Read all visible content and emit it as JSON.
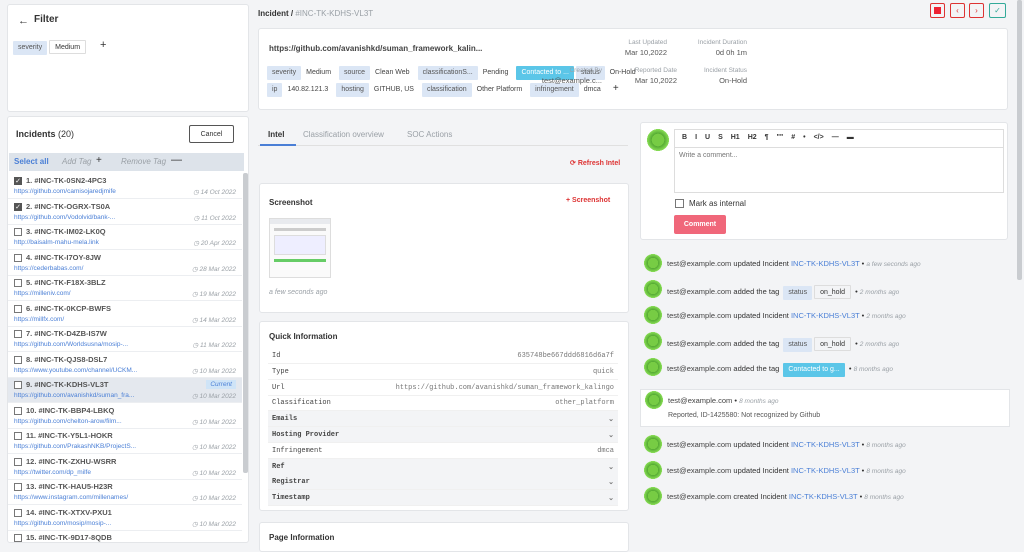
{
  "filter": {
    "title": "Filter",
    "chips": [
      {
        "key": "severity",
        "value": "Medium"
      }
    ]
  },
  "incidents": {
    "title": "Incidents",
    "count": "(20)",
    "cancel": "Cancel",
    "select_all": "Select all",
    "add_tag": "Add Tag",
    "remove_tag": "Remove Tag",
    "current_label": "Current",
    "items": [
      {
        "id": "1. #INC-TK-0SN2-4PC3",
        "url": "https://github.com/camisojaredjmife",
        "date": "14 Oct 2022",
        "checked": true
      },
      {
        "id": "2. #INC-TK-OGRX-TS0A",
        "url": "https://github.com/Vodolvid/bank-...",
        "date": "11 Oct 2022",
        "checked": true
      },
      {
        "id": "3. #INC-TK-IM02-LK0Q",
        "url": "http://baisalm-mahu-mela.link",
        "date": "20 Apr 2022",
        "checked": false
      },
      {
        "id": "4. #INC-TK-I7OY-8JW",
        "url": "https://cederbabas.com/",
        "date": "28 Mar 2022",
        "checked": false
      },
      {
        "id": "5. #INC-TK-F18X-3BLZ",
        "url": "https://milleniv.com/",
        "date": "19 Mar 2022",
        "checked": false
      },
      {
        "id": "6. #INC-TK-0KCP-BWFS",
        "url": "https://millfx.com/",
        "date": "14 Mar 2022",
        "checked": false
      },
      {
        "id": "7. #INC-TK-D4ZB-IS7W",
        "url": "https://github.com/Worldsusna/mosip-...",
        "date": "11 Mar 2022",
        "checked": false
      },
      {
        "id": "8. #INC-TK-QJS8-DSL7",
        "url": "https://www.youtube.com/channel/UCKM...",
        "date": "10 Mar 2022",
        "checked": false
      },
      {
        "id": "9. #INC-TK-KDHS-VL3T",
        "url": "https://github.com/avanishkd/suman_fra...",
        "date": "10 Mar 2022",
        "checked": false,
        "current": true
      },
      {
        "id": "10. #INC-TK-BBP4-LBKQ",
        "url": "https://github.com/chelton-arow/film...",
        "date": "10 Mar 2022",
        "checked": false
      },
      {
        "id": "11. #INC-TK-Y5L1-HOKR",
        "url": "https://github.com/PrakashNKB/ProjectS...",
        "date": "10 Mar 2022",
        "checked": false
      },
      {
        "id": "12. #INC-TK-ZXHU-WSRR",
        "url": "https://twitter.com/dp_milfe",
        "date": "10 Mar 2022",
        "checked": false
      },
      {
        "id": "13. #INC-TK-HAU5-H23R",
        "url": "https://www.instagram.com/millenames/",
        "date": "10 Mar 2022",
        "checked": false
      },
      {
        "id": "14. #INC-TK-XTXV-PXU1",
        "url": "https://github.com/mosip/mosip-...",
        "date": "10 Mar 2022",
        "checked": false
      },
      {
        "id": "15. #INC-TK-9D17-8QDB",
        "url": "",
        "date": "",
        "checked": false
      }
    ]
  },
  "header": {
    "crumb_label": "Incident /",
    "crumb_id": "#INC-TK-KDHS-VL3T"
  },
  "summary": {
    "url": "https://github.com/avanishkd/suman_framework_kalin...",
    "tags_row1": [
      {
        "k": "severity",
        "v": "Medium"
      },
      {
        "k": "source",
        "v": "Clean Web"
      },
      {
        "k": "classificationS...",
        "v": "Pending"
      },
      {
        "k": "Contacted to ...",
        "v": "",
        "highlight": true
      },
      {
        "k": "status",
        "v": "On-Hold"
      }
    ],
    "tags_row2": [
      {
        "k": "ip",
        "v": "140.82.121.3"
      },
      {
        "k": "hosting",
        "v": "GITHUB, US"
      },
      {
        "k": "classification",
        "v": "Other Platform"
      },
      {
        "k": "infringement",
        "v": "dmca"
      }
    ],
    "meta": [
      {
        "label": "Last Updated",
        "value": "Mar 10,2022"
      },
      {
        "label": "Incident Duration",
        "value": "0d 0h 1m"
      },
      {
        "label": "Created By",
        "value": "test@example.c..."
      },
      {
        "label": "Reported Date",
        "value": "Mar 10,2022"
      },
      {
        "label": "Incident Status",
        "value": "On-Hold"
      }
    ]
  },
  "tabs": [
    "Intel",
    "Classification overview",
    "SOC Actions"
  ],
  "refresh": "Refresh Intel",
  "screenshot": {
    "title": "Screenshot",
    "button": "Screenshot",
    "time": "a few seconds ago"
  },
  "quick": {
    "title": "Quick Information",
    "rows": [
      {
        "k": "Id",
        "v": "635748be667ddd6816d6a7f"
      },
      {
        "k": "Type",
        "v": "quick"
      },
      {
        "k": "Url",
        "v": "https://github.com/avanishkd/suman_framework_kalingo"
      },
      {
        "k": "Classification",
        "v": "other_platform"
      },
      {
        "k": "Emails",
        "v": "",
        "collapsible": true
      },
      {
        "k": "Hosting Provider",
        "v": "",
        "collapsible": true
      },
      {
        "k": "Infringement",
        "v": "dmca"
      },
      {
        "k": "Ref",
        "v": "",
        "collapsible": true
      },
      {
        "k": "Registrar",
        "v": "",
        "collapsible": true
      },
      {
        "k": "Timestamp",
        "v": "",
        "collapsible": true
      }
    ]
  },
  "page_info": {
    "title": "Page Information"
  },
  "editor": {
    "placeholder": "Write a comment...",
    "toolbar": [
      "B",
      "I",
      "U",
      "S",
      "H1",
      "H2",
      "¶",
      "\"\"",
      "#",
      "•",
      "</>",
      "—",
      "▬"
    ],
    "mark_internal": "Mark as internal",
    "comment": "Comment"
  },
  "activity": [
    {
      "user": "test@example.com",
      "action": "updated Incident",
      "target": "INC-TK-KDHS-VL3T",
      "time": "a few seconds ago"
    },
    {
      "user": "test@example.com",
      "action": "added the tag",
      "tag": "status",
      "tagv": "on_hold",
      "time": "2 months ago"
    },
    {
      "user": "test@example.com",
      "action": "updated Incident",
      "target": "INC-TK-KDHS-VL3T",
      "time": "2 months ago"
    },
    {
      "user": "test@example.com",
      "action": "added the tag",
      "tag": "status",
      "tagv": "on_hold",
      "time": "2 months ago"
    },
    {
      "user": "test@example.com",
      "action": "added the tag",
      "tag": "Contacted to g...",
      "tagv": "",
      "time": "8 months ago",
      "tagHighlight": true
    },
    {
      "user": "test@example.com",
      "action": "",
      "time": "8 months ago",
      "comment": "Reported, ID-1425580: Not recognized by Github"
    },
    {
      "user": "test@example.com",
      "action": "updated Incident",
      "target": "INC-TK-KDHS-VL3T",
      "time": "8 months ago"
    },
    {
      "user": "test@example.com",
      "action": "updated Incident",
      "target": "INC-TK-KDHS-VL3T",
      "time": "8 months ago"
    },
    {
      "user": "test@example.com",
      "action": "created Incident",
      "target": "INC-TK-KDHS-VL3T",
      "time": "8 months ago"
    }
  ]
}
